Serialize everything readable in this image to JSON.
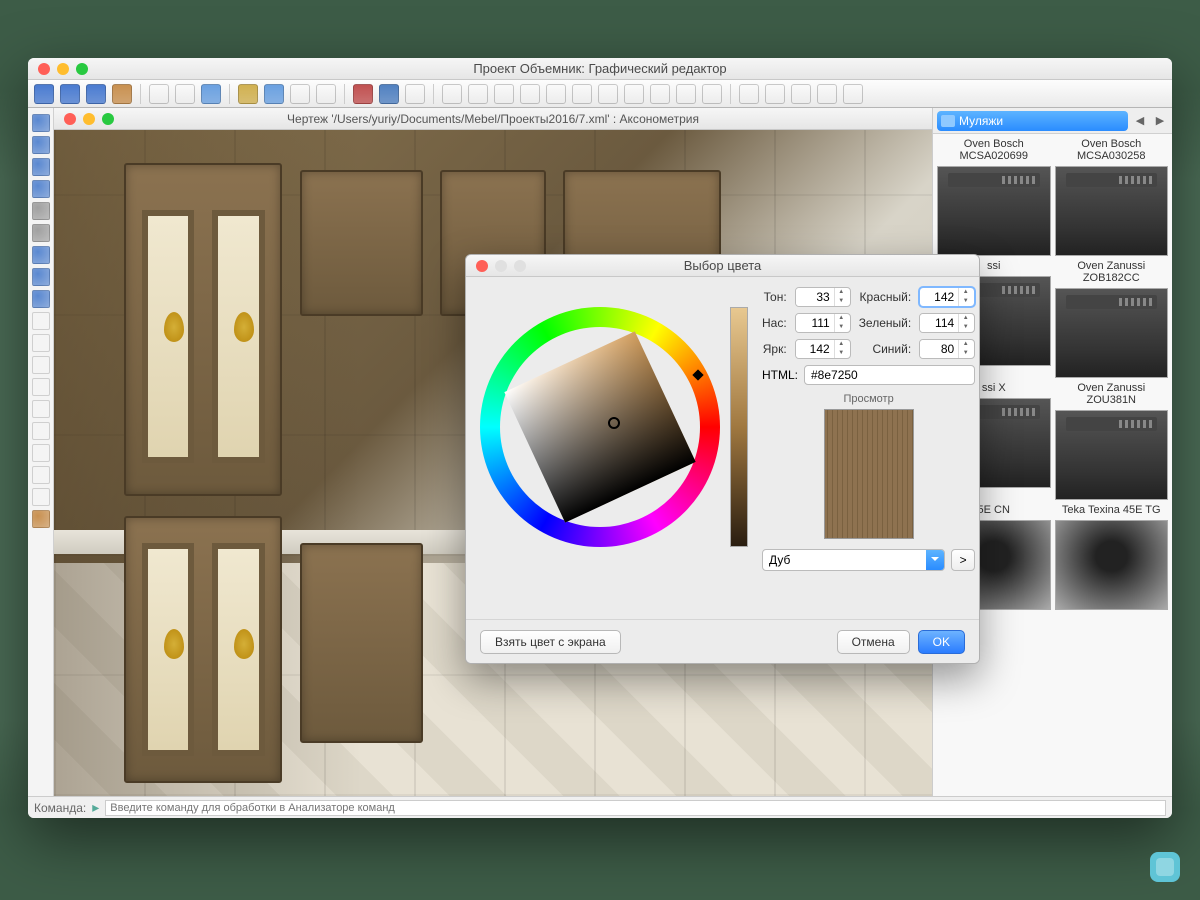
{
  "mainWindow": {
    "title": "Проект Объемник: Графический редактор"
  },
  "docWindow": {
    "title": "Чертеж '/Users/yuriy/Documents/Mebel/Проекты2016/7.xml' : Аксонометрия"
  },
  "commandBar": {
    "label": "Команда:",
    "placeholder": "Введите команду для обработки в Анализаторе команд"
  },
  "rightPanel": {
    "category": "Муляжи",
    "items": [
      {
        "name": "Oven Bosch MCSA020699"
      },
      {
        "name": "Oven Bosch MCSA030258"
      },
      {
        "name": "ssi"
      },
      {
        "name": "Oven Zanussi ZOB182CC"
      },
      {
        "name": "ssi X"
      },
      {
        "name": "Oven Zanussi ZOU381N"
      },
      {
        "name": "5E CN"
      },
      {
        "name": "Teka Texina 45E TG"
      }
    ]
  },
  "colorDialog": {
    "title": "Выбор цвета",
    "labels": {
      "hue": "Тон:",
      "sat": "Нас:",
      "val": "Ярк:",
      "red": "Красный:",
      "green": "Зеленый:",
      "blue": "Синий:",
      "html": "HTML:",
      "preview": "Просмотр"
    },
    "values": {
      "hue": "33",
      "sat": "111",
      "val": "142",
      "red": "142",
      "green": "114",
      "blue": "80",
      "html": "#8e7250"
    },
    "material": "Дуб",
    "buttons": {
      "pick": "Взять цвет с экрана",
      "browse": ">",
      "cancel": "Отмена",
      "ok": "OK"
    }
  },
  "toolbarIconColors": [
    "#4a7bd0",
    "#4a7bd0",
    "#4a7bd0",
    "#c89050",
    "#888",
    "#888",
    "#6aa0e0",
    "#d0b050",
    "#6aa0e0",
    "#888",
    "#888",
    "#c05050",
    "#5080c0",
    "#888",
    "#888",
    "#888",
    "#888",
    "#888",
    "#888",
    "#888",
    "#888",
    "#888",
    "#888",
    "#888",
    "#888",
    "#888",
    "#888",
    "#888",
    "#888",
    "#888"
  ],
  "leftToolColors": [
    "#5a88d0",
    "#5a88d0",
    "#5a88d0",
    "#5a88d0",
    "#a0a0a0",
    "#a0a0a0",
    "#5a88d0",
    "#5a88d0",
    "#5a88d0",
    "#888",
    "#888",
    "#888",
    "#888",
    "#888",
    "#888",
    "#888",
    "#888",
    "#888",
    "#c89050"
  ]
}
